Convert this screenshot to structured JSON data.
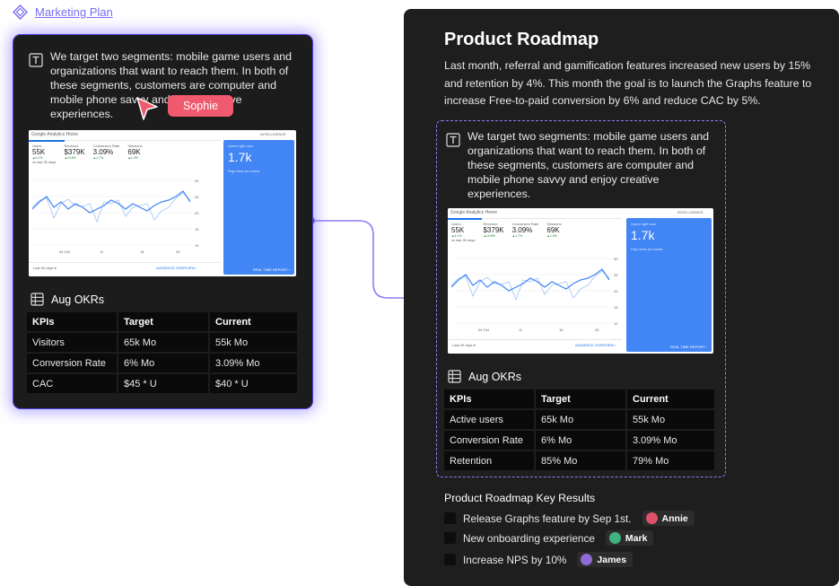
{
  "breadcrumb": {
    "icon": "diamond-icon",
    "label": "Marketing Plan"
  },
  "left_card": {
    "paragraph": "We target two segments: mobile game users and organizations that want to reach them. In both of these segments, customers are computer and mobile phone savvy and enjoy creative experiences.",
    "okr_title": "Aug OKRs",
    "table": {
      "headers": [
        "KPIs",
        "Target",
        "Current"
      ],
      "rows": [
        [
          "Visitors",
          "65k Mo",
          "55k Mo"
        ],
        [
          "Conversion Rate",
          "6% Mo",
          "3.09% Mo"
        ],
        [
          "CAC",
          "$45 * U",
          "$40 * U"
        ]
      ]
    }
  },
  "collaborator_cursor": {
    "name": "Sophie",
    "color": "#ef5a6f"
  },
  "analytics": {
    "header": "Google Analytics Home",
    "badge": "INTELLIGENCE",
    "metrics": [
      {
        "label": "Users",
        "value": "55K",
        "change": "▲4.1%"
      },
      {
        "label": "Revenue",
        "value": "$379K",
        "change": "▲19.8%"
      },
      {
        "label": "Conversion Rate",
        "value": "3.09%",
        "change": "▲1.7%"
      },
      {
        "label": "Sessions",
        "value": "69K",
        "change": "▲1.3%"
      }
    ],
    "sub": "vs last 30 days",
    "blue_label": "Users right now",
    "blue_value": "1.7k",
    "blue_sub": "Page views per minute",
    "range": "Last 30 days ▾",
    "audience_link": "AUDIENCE OVERVIEW ›",
    "realtime_link": "REAL TIME REPORT ›",
    "y_ticks": [
      "30",
      "25",
      "20",
      "15",
      "10"
    ],
    "x_ticks": [
      "04 Oct",
      "11",
      "18",
      "25"
    ]
  },
  "right_panel": {
    "title": "Product Roadmap",
    "description": "Last month, referral and gamification features increased new users by 15% and retention by 4%. This month the goal is to launch the Graphs feature to increase Free-to-paid conversion by 6% and reduce CAC by 5%.",
    "paragraph": "We target two segments: mobile game users and organizations that want to reach them. In both of these segments, customers are computer and mobile phone savvy and enjoy creative experiences.",
    "okr_title": "Aug OKRs",
    "table": {
      "headers": [
        "KPIs",
        "Target",
        "Current"
      ],
      "rows": [
        [
          "Active users",
          "65k Mo",
          "55k Mo"
        ],
        [
          "Conversion Rate",
          "6% Mo",
          "3.09% Mo"
        ],
        [
          "Retention",
          "85% Mo",
          "79% Mo"
        ]
      ]
    },
    "key_results_title": "Product Roadmap Key Results",
    "key_results": [
      {
        "label": "Release Graphs feature by Sep 1st.",
        "assignee": "Annie",
        "avatar_color": "#e0526a"
      },
      {
        "label": "New onboarding experience",
        "assignee": "Mark",
        "avatar_color": "#3fb37f"
      },
      {
        "label": "Increase NPS by 10%",
        "assignee": "James",
        "avatar_color": "#8f6ad8"
      }
    ]
  },
  "colors": {
    "accent": "#7b6cf0",
    "panel": "#1e1e1e",
    "table_cell": "#0a0a0a",
    "analytics_blue": "#4285f4"
  }
}
